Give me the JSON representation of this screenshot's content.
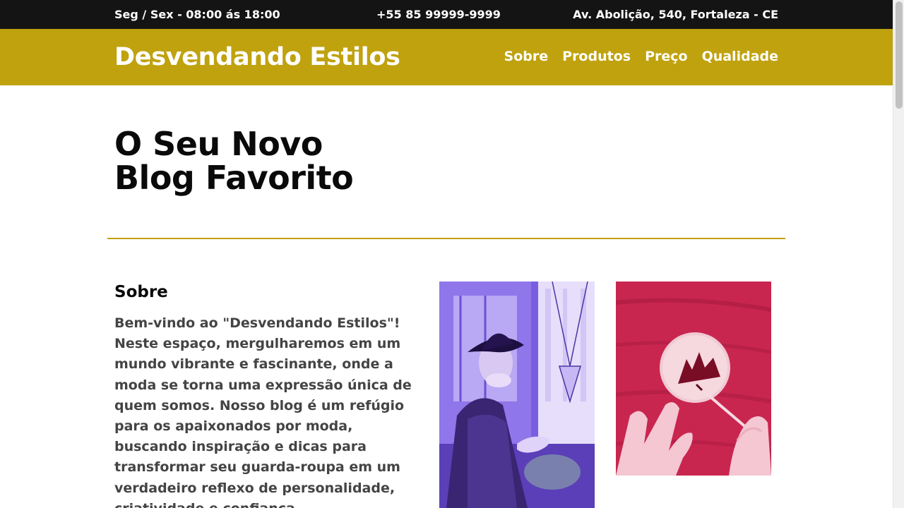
{
  "topbar": {
    "hours": "Seg / Sex - 08:00 ás 18:00",
    "phone": "+55 85 99999-9999",
    "address": "Av. Abolição, 540, Fortaleza - CE"
  },
  "header": {
    "brand": "Desvendando Estilos",
    "nav": [
      "Sobre",
      "Produtos",
      "Preço",
      "Qualidade"
    ]
  },
  "hero": {
    "title_line1": "O Seu Novo",
    "title_line2": "Blog Favorito"
  },
  "about": {
    "title": "Sobre",
    "text": "Bem-vindo ao \"Desvendando Estilos\"! Neste espaço, mergulharemos em um mundo vibrante e fascinante, onde a moda se torna uma expressão única de quem somos. Nosso blog é um refúgio para os apaixonados por moda, buscando inspiração e dicas para transformar seu guarda-roupa em um verdadeiro reflexo de personalidade, criatividade e confiança."
  },
  "colors": {
    "accent": "#bfa20e",
    "topbar_bg": "#141414",
    "photo_purple": "#6a4bcf",
    "photo_red": "#c9264f"
  }
}
